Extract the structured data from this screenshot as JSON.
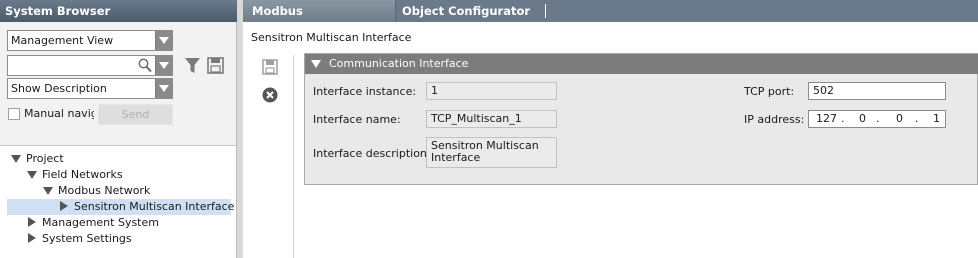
{
  "system_browser": {
    "title": "System Browser",
    "view_select": "Management View",
    "search_value": "",
    "description_select": "Show Description",
    "manual_navigation_label": "Manual navigation",
    "manual_navigation_checked": false,
    "send_label": "Send",
    "tree": [
      {
        "label": "Project",
        "state": "expanded",
        "level": 0
      },
      {
        "label": "Field Networks",
        "state": "expanded",
        "level": 1
      },
      {
        "label": "Modbus Network",
        "state": "expanded",
        "level": 2
      },
      {
        "label": "Sensitron Multiscan Interface",
        "state": "collapsed",
        "level": 3,
        "selected": true
      },
      {
        "label": "Management System",
        "state": "collapsed",
        "level": 1
      },
      {
        "label": "System Settings",
        "state": "collapsed",
        "level": 1
      }
    ]
  },
  "tabs": [
    {
      "label": "Modbus",
      "active": true
    },
    {
      "label": "Object Configurator",
      "active": false
    }
  ],
  "page": {
    "title": "Sensitron Multiscan Interface"
  },
  "communication_interface": {
    "header": "Communication Interface",
    "instance_label": "Interface instance:",
    "instance_value": "1",
    "name_label": "Interface name:",
    "name_value": "TCP_Multiscan_1",
    "description_label": "Interface description:",
    "description_value": "Sensitron Multiscan Interface",
    "tcp_port_label": "TCP port:",
    "tcp_port_value": "502",
    "ip_label": "IP address:",
    "ip_octets": [
      "127",
      "0",
      "0",
      "1"
    ],
    "ip_separator": "."
  },
  "colors": {
    "title_bar": "#5a6978",
    "header_bar": "#7c7c7c",
    "selection": "#cfe0f5",
    "panel_bg": "#e9e9e9"
  },
  "icons": [
    "search-icon",
    "dropdown-arrow-icon",
    "filter-icon",
    "save-disk-icon",
    "cancel-icon",
    "expand-triangle-icon",
    "collapse-triangle-icon"
  ]
}
